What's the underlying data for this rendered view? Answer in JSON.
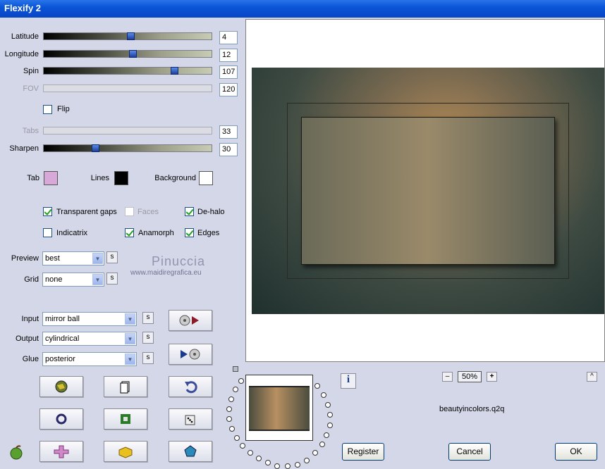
{
  "window": {
    "title": "Flexify 2"
  },
  "sliders": [
    {
      "key": "latitude",
      "label": "Latitude",
      "value": "4",
      "fraction": 0.52,
      "enabled": true
    },
    {
      "key": "longitude",
      "label": "Longitude",
      "value": "12",
      "fraction": 0.53,
      "enabled": true
    },
    {
      "key": "spin",
      "label": "Spin",
      "value": "107",
      "fraction": 0.79,
      "enabled": true
    },
    {
      "key": "fov",
      "label": "FOV",
      "value": "120",
      "fraction": 0.0,
      "enabled": false
    },
    {
      "key": "tabs",
      "label": "Tabs",
      "value": "33",
      "fraction": 0.0,
      "enabled": false
    },
    {
      "key": "sharpen",
      "label": "Sharpen",
      "value": "30",
      "fraction": 0.3,
      "enabled": true
    }
  ],
  "flip": {
    "label": "Flip",
    "checked": false
  },
  "colors": {
    "tab_label": "Tab",
    "tab_color": "#d8a8d8",
    "lines_label": "Lines",
    "lines_color": "#000000",
    "background_label": "Background",
    "background_color": "#ffffff"
  },
  "options": {
    "transparent_gaps": {
      "label": "Transparent gaps",
      "checked": true
    },
    "faces": {
      "label": "Faces",
      "checked": false
    },
    "dehalo": {
      "label": "De-halo",
      "checked": true
    },
    "indicatrix": {
      "label": "Indicatrix",
      "checked": false
    },
    "anamorph": {
      "label": "Anamorph",
      "checked": true
    },
    "edges": {
      "label": "Edges",
      "checked": true
    }
  },
  "preview": {
    "label": "Preview",
    "value": "best"
  },
  "grid": {
    "label": "Grid",
    "value": "none"
  },
  "watermark": {
    "name": "Pinuccia",
    "url": "www.maidiregrafica.eu"
  },
  "projection": {
    "input_label": "Input",
    "input_value": "mirror ball",
    "output_label": "Output",
    "output_value": "cylindrical",
    "glue_label": "Glue",
    "glue_value": "posterior"
  },
  "s_button": "s",
  "zoom": {
    "minus": "–",
    "value": "50%",
    "plus": "+"
  },
  "collapse": "^",
  "info": "i",
  "filename": "beautyincolors.q2q",
  "buttons": {
    "register": "Register",
    "cancel": "Cancel",
    "ok": "OK"
  },
  "icons": [
    "globe-icon",
    "page-icon",
    "undo-icon",
    "ring-icon",
    "square-icon",
    "dice-icon",
    "puzzle-cross-icon",
    "lego-brick-icon",
    "pentagon-icon",
    "apple-icon",
    "play-to-disc-icon",
    "disc-to-play-icon"
  ]
}
